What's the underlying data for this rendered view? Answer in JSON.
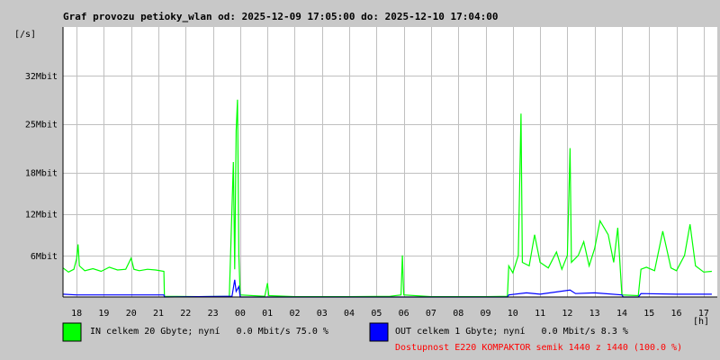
{
  "chart_data": {
    "type": "line",
    "title": "Graf provozu petioky_wlan od: 2025-12-09 17:05:00 do: 2025-12-10 17:04:00",
    "ylabel": "[/s]",
    "xlabel": "[h]",
    "y_unit": "Mbit",
    "ylim": [
      0,
      39
    ],
    "y_ticks": [
      {
        "value": 6,
        "label": "6Mbit"
      },
      {
        "value": 12,
        "label": "12Mbit"
      },
      {
        "value": 18,
        "label": "18Mbit"
      },
      {
        "value": 25,
        "label": "25Mbit"
      },
      {
        "value": 32,
        "label": "32Mbit"
      }
    ],
    "x_range": [
      17.5,
      41.5
    ],
    "x_ticks": [
      {
        "value": 18,
        "label": "18"
      },
      {
        "value": 19,
        "label": "19"
      },
      {
        "value": 20,
        "label": "20"
      },
      {
        "value": 21,
        "label": "21"
      },
      {
        "value": 22,
        "label": "22"
      },
      {
        "value": 23,
        "label": "23"
      },
      {
        "value": 24,
        "label": "00"
      },
      {
        "value": 25,
        "label": "01"
      },
      {
        "value": 26,
        "label": "02"
      },
      {
        "value": 27,
        "label": "03"
      },
      {
        "value": 28,
        "label": "04"
      },
      {
        "value": 29,
        "label": "05"
      },
      {
        "value": 30,
        "label": "06"
      },
      {
        "value": 31,
        "label": "07"
      },
      {
        "value": 32,
        "label": "08"
      },
      {
        "value": 33,
        "label": "09"
      },
      {
        "value": 34,
        "label": "10"
      },
      {
        "value": 35,
        "label": "11"
      },
      {
        "value": 36,
        "label": "12"
      },
      {
        "value": 37,
        "label": "13"
      },
      {
        "value": 38,
        "label": "14"
      },
      {
        "value": 39,
        "label": "15"
      },
      {
        "value": 40,
        "label": "16"
      },
      {
        "value": 41,
        "label": "17"
      }
    ],
    "grid": true,
    "series": [
      {
        "name": "IN",
        "color": "#00ff00",
        "points": [
          [
            17.5,
            4.2
          ],
          [
            17.7,
            3.6
          ],
          [
            17.9,
            4.0
          ],
          [
            18.0,
            5.5
          ],
          [
            18.05,
            7.6
          ],
          [
            18.1,
            4.5
          ],
          [
            18.3,
            3.8
          ],
          [
            18.6,
            4.1
          ],
          [
            18.9,
            3.7
          ],
          [
            19.2,
            4.3
          ],
          [
            19.5,
            3.9
          ],
          [
            19.8,
            4.0
          ],
          [
            20.0,
            5.6
          ],
          [
            20.1,
            4.0
          ],
          [
            20.3,
            3.8
          ],
          [
            20.6,
            4.0
          ],
          [
            20.9,
            3.9
          ],
          [
            21.2,
            3.7
          ],
          [
            21.22,
            0.1
          ],
          [
            22.5,
            0.05
          ],
          [
            23.6,
            0.1
          ],
          [
            23.75,
            19.5
          ],
          [
            23.8,
            4.0
          ],
          [
            23.85,
            24.0
          ],
          [
            23.9,
            28.5
          ],
          [
            23.95,
            6.0
          ],
          [
            24.0,
            0.3
          ],
          [
            24.9,
            0.1
          ],
          [
            25.0,
            2.0
          ],
          [
            25.05,
            0.2
          ],
          [
            26.0,
            0.05
          ],
          [
            27.0,
            0.05
          ],
          [
            28.0,
            0.05
          ],
          [
            29.5,
            0.1
          ],
          [
            29.9,
            0.3
          ],
          [
            29.95,
            6.0
          ],
          [
            30.0,
            0.3
          ],
          [
            31.0,
            0.05
          ],
          [
            32.0,
            0.05
          ],
          [
            33.0,
            0.05
          ],
          [
            33.8,
            0.1
          ],
          [
            33.85,
            4.5
          ],
          [
            34.0,
            3.5
          ],
          [
            34.2,
            6.0
          ],
          [
            34.3,
            26.5
          ],
          [
            34.35,
            5.0
          ],
          [
            34.6,
            4.5
          ],
          [
            34.8,
            9.0
          ],
          [
            35.0,
            5.0
          ],
          [
            35.3,
            4.2
          ],
          [
            35.6,
            6.5
          ],
          [
            35.8,
            4.0
          ],
          [
            36.0,
            6.0
          ],
          [
            36.1,
            21.5
          ],
          [
            36.15,
            5.0
          ],
          [
            36.4,
            6.0
          ],
          [
            36.6,
            8.0
          ],
          [
            36.8,
            4.5
          ],
          [
            37.0,
            7.0
          ],
          [
            37.2,
            11.0
          ],
          [
            37.5,
            9.0
          ],
          [
            37.7,
            5.0
          ],
          [
            37.85,
            10.0
          ],
          [
            38.0,
            0.3
          ],
          [
            38.6,
            0.2
          ],
          [
            38.7,
            4.0
          ],
          [
            38.9,
            4.3
          ],
          [
            39.2,
            3.8
          ],
          [
            39.5,
            9.5
          ],
          [
            39.8,
            4.2
          ],
          [
            40.0,
            3.8
          ],
          [
            40.3,
            6.0
          ],
          [
            40.5,
            10.5
          ],
          [
            40.7,
            4.5
          ],
          [
            41.0,
            3.6
          ],
          [
            41.3,
            3.7
          ]
        ]
      },
      {
        "name": "OUT",
        "color": "#0000ff",
        "points": [
          [
            17.5,
            0.4
          ],
          [
            18.0,
            0.3
          ],
          [
            19.0,
            0.3
          ],
          [
            20.0,
            0.3
          ],
          [
            21.2,
            0.3
          ],
          [
            21.22,
            0.0
          ],
          [
            23.7,
            0.1
          ],
          [
            23.8,
            2.5
          ],
          [
            23.85,
            0.8
          ],
          [
            23.95,
            1.5
          ],
          [
            24.0,
            0.0
          ],
          [
            33.8,
            0.0
          ],
          [
            33.85,
            0.3
          ],
          [
            34.5,
            0.6
          ],
          [
            35.0,
            0.4
          ],
          [
            36.1,
            1.0
          ],
          [
            36.3,
            0.5
          ],
          [
            37.0,
            0.6
          ],
          [
            38.0,
            0.3
          ],
          [
            38.05,
            0.0
          ],
          [
            38.6,
            0.0
          ],
          [
            38.7,
            0.5
          ],
          [
            40.0,
            0.4
          ],
          [
            41.3,
            0.4
          ]
        ]
      }
    ],
    "legend": [
      {
        "color": "#00ff00",
        "text": "IN celkem 20 Gbyte; nyní   0.0 Mbit/s 75.0 %"
      },
      {
        "color": "#0000ff",
        "text": "OUT celkem 1 Gbyte; nyní   0.0 Mbit/s 8.3 %"
      }
    ],
    "availability": {
      "text": "Dostupnost E220 KOMPAKTOR semik 1440 z 1440 (100.0 %)",
      "color": "#ff0000"
    }
  }
}
